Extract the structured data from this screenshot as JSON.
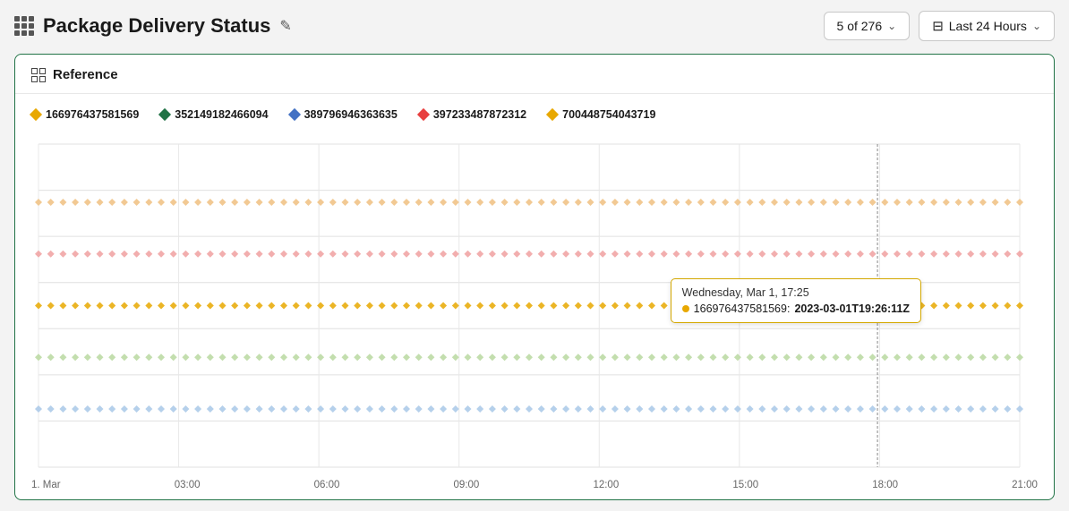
{
  "header": {
    "grid_icon": "grid-icon",
    "title": "Package Delivery Status",
    "edit_icon": "✎",
    "pagination": {
      "label": "5 of 276",
      "chevron": "∨"
    },
    "time_range": {
      "icon": "⊡",
      "label": "Last 24 Hours",
      "chevron": "∨"
    }
  },
  "card": {
    "title": "Reference"
  },
  "legend": {
    "items": [
      {
        "id": "series1",
        "color": "#e8a800",
        "label": "166976437581569"
      },
      {
        "id": "series2",
        "color": "#217346",
        "label": "352149182466094"
      },
      {
        "id": "series3",
        "color": "#4472c4",
        "label": "389796946363635"
      },
      {
        "id": "series4",
        "color": "#e84040",
        "label": "397233487872312"
      },
      {
        "id": "series5",
        "color": "#e8a800",
        "label": "700448754043719"
      }
    ]
  },
  "chart": {
    "x_labels": [
      "1. Mar",
      "03:00",
      "06:00",
      "09:00",
      "12:00",
      "15:00",
      "18:00",
      "21:00"
    ],
    "series": [
      {
        "color": "#f0c080",
        "y_pct": 18
      },
      {
        "color": "#f0a0a0",
        "y_pct": 34
      },
      {
        "color": "#e8a800",
        "y_pct": 50
      },
      {
        "color": "#b8d8a0",
        "y_pct": 66
      },
      {
        "color": "#a8c8e8",
        "y_pct": 82
      }
    ],
    "tooltip": {
      "title": "Wednesday, Mar 1, 17:25",
      "series_label": "166976437581569:",
      "value": "2023-03-01T19:26:11Z",
      "dot_color": "#e8a800"
    },
    "vertical_line_x_pct": 86
  }
}
